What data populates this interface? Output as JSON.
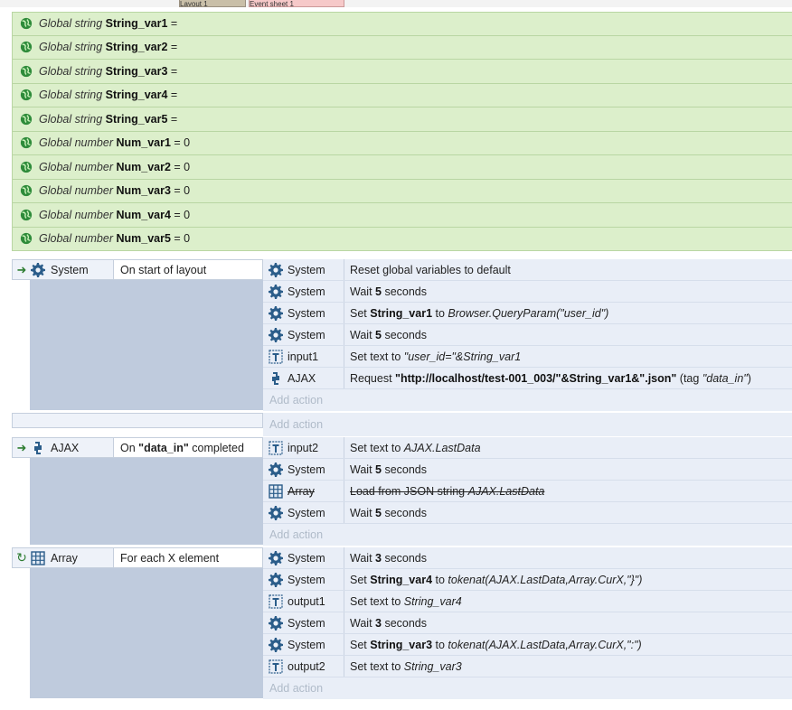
{
  "tabs": {
    "layout": "Layout 1",
    "sheet": "Event sheet 1"
  },
  "globals": [
    {
      "scope": "Global string",
      "name": "String_var1",
      "value": "="
    },
    {
      "scope": "Global string",
      "name": "String_var2",
      "value": "="
    },
    {
      "scope": "Global string",
      "name": "String_var3",
      "value": "="
    },
    {
      "scope": "Global string",
      "name": "String_var4",
      "value": "="
    },
    {
      "scope": "Global string",
      "name": "String_var5",
      "value": "="
    },
    {
      "scope": "Global number",
      "name": "Num_var1",
      "value": "= 0"
    },
    {
      "scope": "Global number",
      "name": "Num_var2",
      "value": "= 0"
    },
    {
      "scope": "Global number",
      "name": "Num_var3",
      "value": "= 0"
    },
    {
      "scope": "Global number",
      "name": "Num_var4",
      "value": "= 0"
    },
    {
      "scope": "Global number",
      "name": "Num_var5",
      "value": "= 0"
    }
  ],
  "events": {
    "e1": {
      "object": "System",
      "trigger": "On start of layout",
      "actions": [
        {
          "obj": "System",
          "icon": "gear-icon",
          "html": "Reset global variables to default"
        },
        {
          "obj": "System",
          "icon": "gear-icon",
          "html": "Wait <b>5</b> seconds"
        },
        {
          "obj": "System",
          "icon": "gear-icon",
          "html": "Set <b>String_var1</b> to <i>Browser.QueryParam(\"user_id\")</i>"
        },
        {
          "obj": "System",
          "icon": "gear-icon",
          "html": "Wait <b>5</b> seconds"
        },
        {
          "obj": "input1",
          "icon": "textbox-icon",
          "html": "Set text to <i>\"user_id=\"&String_var1</i>"
        },
        {
          "obj": "AJAX",
          "icon": "ajax-icon",
          "html": "Request <b>\"http://localhost/test-001_003/\"&String_var1&\".json\"</b> (tag <i>\"data_in\"</i>)"
        }
      ],
      "add_action": "Add action"
    },
    "empty": {
      "add_action": "Add action"
    },
    "e2": {
      "object": "AJAX",
      "trigger_pre": "On ",
      "trigger_bold": "\"data_in\"",
      "trigger_post": " completed",
      "actions": [
        {
          "obj": "input2",
          "icon": "textbox-icon",
          "html": "Set text to <i>AJAX.LastData</i>"
        },
        {
          "obj": "System",
          "icon": "gear-icon",
          "html": "Wait <b>5</b> seconds"
        },
        {
          "obj": "Array",
          "icon": "array-icon",
          "strike": true,
          "html": "Load from JSON string <i>AJAX.LastData</i>"
        },
        {
          "obj": "System",
          "icon": "gear-icon",
          "html": "Wait <b>5</b> seconds"
        }
      ],
      "add_action": "Add action"
    },
    "e3": {
      "object": "Array",
      "trigger": "For each X element",
      "actions": [
        {
          "obj": "System",
          "icon": "gear-icon",
          "html": "Wait <b>3</b> seconds"
        },
        {
          "obj": "System",
          "icon": "gear-icon",
          "html": "Set <b>String_var4</b> to <i>tokenat(AJAX.LastData,Array.CurX,\"}\")</i>"
        },
        {
          "obj": "output1",
          "icon": "textbox-icon",
          "html": "Set text to <i>String_var4</i>"
        },
        {
          "obj": "System",
          "icon": "gear-icon",
          "html": "Wait <b>3</b> seconds"
        },
        {
          "obj": "System",
          "icon": "gear-icon",
          "html": "Set <b>String_var3</b> to <i>tokenat(AJAX.LastData,Array.CurX,\":\")</i>"
        },
        {
          "obj": "output2",
          "icon": "textbox-icon",
          "html": "Set text to <i>String_var3</i>"
        }
      ],
      "add_action": "Add action"
    }
  }
}
